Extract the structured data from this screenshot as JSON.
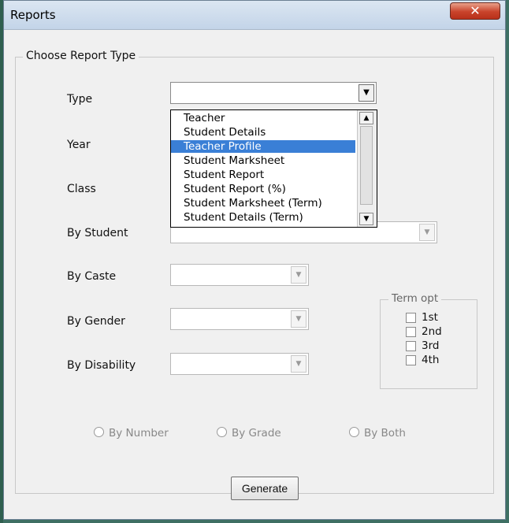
{
  "window": {
    "title": "Reports",
    "close_glyph": "✕"
  },
  "group": {
    "title": "Choose Report Type"
  },
  "labels": {
    "type": "Type",
    "year": "Year",
    "class": "Class",
    "by_student": "By Student",
    "by_caste": "By Caste",
    "by_gender": "By Gender",
    "by_disability": "By Disability"
  },
  "type_dropdown": {
    "value": "",
    "options": [
      "Teacher",
      "Student Details",
      "Teacher Profile",
      "Student Marksheet",
      "Student Report",
      "Student Report (%)",
      "Student Marksheet (Term)",
      "Student Details (Term)"
    ],
    "highlighted": "Teacher Profile"
  },
  "term_options": {
    "legend": "Term opt",
    "items": [
      "1st",
      "2nd",
      "3rd",
      "4th"
    ]
  },
  "radios": [
    "By Number",
    "By Grade",
    "By Both"
  ],
  "generate_label": "Generate",
  "icons": {
    "dropdown_arrow": "▼",
    "scroll_up": "▲",
    "scroll_down": "▼"
  },
  "colors": {
    "selection": "#3a7fd6",
    "close_button": "#c9432b"
  }
}
